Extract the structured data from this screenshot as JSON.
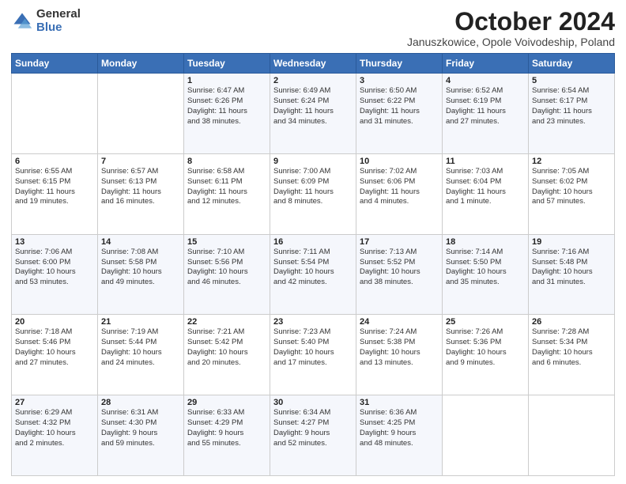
{
  "logo": {
    "general": "General",
    "blue": "Blue"
  },
  "header": {
    "title": "October 2024",
    "subtitle": "Januszkowice, Opole Voivodeship, Poland"
  },
  "weekdays": [
    "Sunday",
    "Monday",
    "Tuesday",
    "Wednesday",
    "Thursday",
    "Friday",
    "Saturday"
  ],
  "weeks": [
    [
      {
        "day": "",
        "info": ""
      },
      {
        "day": "",
        "info": ""
      },
      {
        "day": "1",
        "info": "Sunrise: 6:47 AM\nSunset: 6:26 PM\nDaylight: 11 hours\nand 38 minutes."
      },
      {
        "day": "2",
        "info": "Sunrise: 6:49 AM\nSunset: 6:24 PM\nDaylight: 11 hours\nand 34 minutes."
      },
      {
        "day": "3",
        "info": "Sunrise: 6:50 AM\nSunset: 6:22 PM\nDaylight: 11 hours\nand 31 minutes."
      },
      {
        "day": "4",
        "info": "Sunrise: 6:52 AM\nSunset: 6:19 PM\nDaylight: 11 hours\nand 27 minutes."
      },
      {
        "day": "5",
        "info": "Sunrise: 6:54 AM\nSunset: 6:17 PM\nDaylight: 11 hours\nand 23 minutes."
      }
    ],
    [
      {
        "day": "6",
        "info": "Sunrise: 6:55 AM\nSunset: 6:15 PM\nDaylight: 11 hours\nand 19 minutes."
      },
      {
        "day": "7",
        "info": "Sunrise: 6:57 AM\nSunset: 6:13 PM\nDaylight: 11 hours\nand 16 minutes."
      },
      {
        "day": "8",
        "info": "Sunrise: 6:58 AM\nSunset: 6:11 PM\nDaylight: 11 hours\nand 12 minutes."
      },
      {
        "day": "9",
        "info": "Sunrise: 7:00 AM\nSunset: 6:09 PM\nDaylight: 11 hours\nand 8 minutes."
      },
      {
        "day": "10",
        "info": "Sunrise: 7:02 AM\nSunset: 6:06 PM\nDaylight: 11 hours\nand 4 minutes."
      },
      {
        "day": "11",
        "info": "Sunrise: 7:03 AM\nSunset: 6:04 PM\nDaylight: 11 hours\nand 1 minute."
      },
      {
        "day": "12",
        "info": "Sunrise: 7:05 AM\nSunset: 6:02 PM\nDaylight: 10 hours\nand 57 minutes."
      }
    ],
    [
      {
        "day": "13",
        "info": "Sunrise: 7:06 AM\nSunset: 6:00 PM\nDaylight: 10 hours\nand 53 minutes."
      },
      {
        "day": "14",
        "info": "Sunrise: 7:08 AM\nSunset: 5:58 PM\nDaylight: 10 hours\nand 49 minutes."
      },
      {
        "day": "15",
        "info": "Sunrise: 7:10 AM\nSunset: 5:56 PM\nDaylight: 10 hours\nand 46 minutes."
      },
      {
        "day": "16",
        "info": "Sunrise: 7:11 AM\nSunset: 5:54 PM\nDaylight: 10 hours\nand 42 minutes."
      },
      {
        "day": "17",
        "info": "Sunrise: 7:13 AM\nSunset: 5:52 PM\nDaylight: 10 hours\nand 38 minutes."
      },
      {
        "day": "18",
        "info": "Sunrise: 7:14 AM\nSunset: 5:50 PM\nDaylight: 10 hours\nand 35 minutes."
      },
      {
        "day": "19",
        "info": "Sunrise: 7:16 AM\nSunset: 5:48 PM\nDaylight: 10 hours\nand 31 minutes."
      }
    ],
    [
      {
        "day": "20",
        "info": "Sunrise: 7:18 AM\nSunset: 5:46 PM\nDaylight: 10 hours\nand 27 minutes."
      },
      {
        "day": "21",
        "info": "Sunrise: 7:19 AM\nSunset: 5:44 PM\nDaylight: 10 hours\nand 24 minutes."
      },
      {
        "day": "22",
        "info": "Sunrise: 7:21 AM\nSunset: 5:42 PM\nDaylight: 10 hours\nand 20 minutes."
      },
      {
        "day": "23",
        "info": "Sunrise: 7:23 AM\nSunset: 5:40 PM\nDaylight: 10 hours\nand 17 minutes."
      },
      {
        "day": "24",
        "info": "Sunrise: 7:24 AM\nSunset: 5:38 PM\nDaylight: 10 hours\nand 13 minutes."
      },
      {
        "day": "25",
        "info": "Sunrise: 7:26 AM\nSunset: 5:36 PM\nDaylight: 10 hours\nand 9 minutes."
      },
      {
        "day": "26",
        "info": "Sunrise: 7:28 AM\nSunset: 5:34 PM\nDaylight: 10 hours\nand 6 minutes."
      }
    ],
    [
      {
        "day": "27",
        "info": "Sunrise: 6:29 AM\nSunset: 4:32 PM\nDaylight: 10 hours\nand 2 minutes."
      },
      {
        "day": "28",
        "info": "Sunrise: 6:31 AM\nSunset: 4:30 PM\nDaylight: 9 hours\nand 59 minutes."
      },
      {
        "day": "29",
        "info": "Sunrise: 6:33 AM\nSunset: 4:29 PM\nDaylight: 9 hours\nand 55 minutes."
      },
      {
        "day": "30",
        "info": "Sunrise: 6:34 AM\nSunset: 4:27 PM\nDaylight: 9 hours\nand 52 minutes."
      },
      {
        "day": "31",
        "info": "Sunrise: 6:36 AM\nSunset: 4:25 PM\nDaylight: 9 hours\nand 48 minutes."
      },
      {
        "day": "",
        "info": ""
      },
      {
        "day": "",
        "info": ""
      }
    ]
  ]
}
